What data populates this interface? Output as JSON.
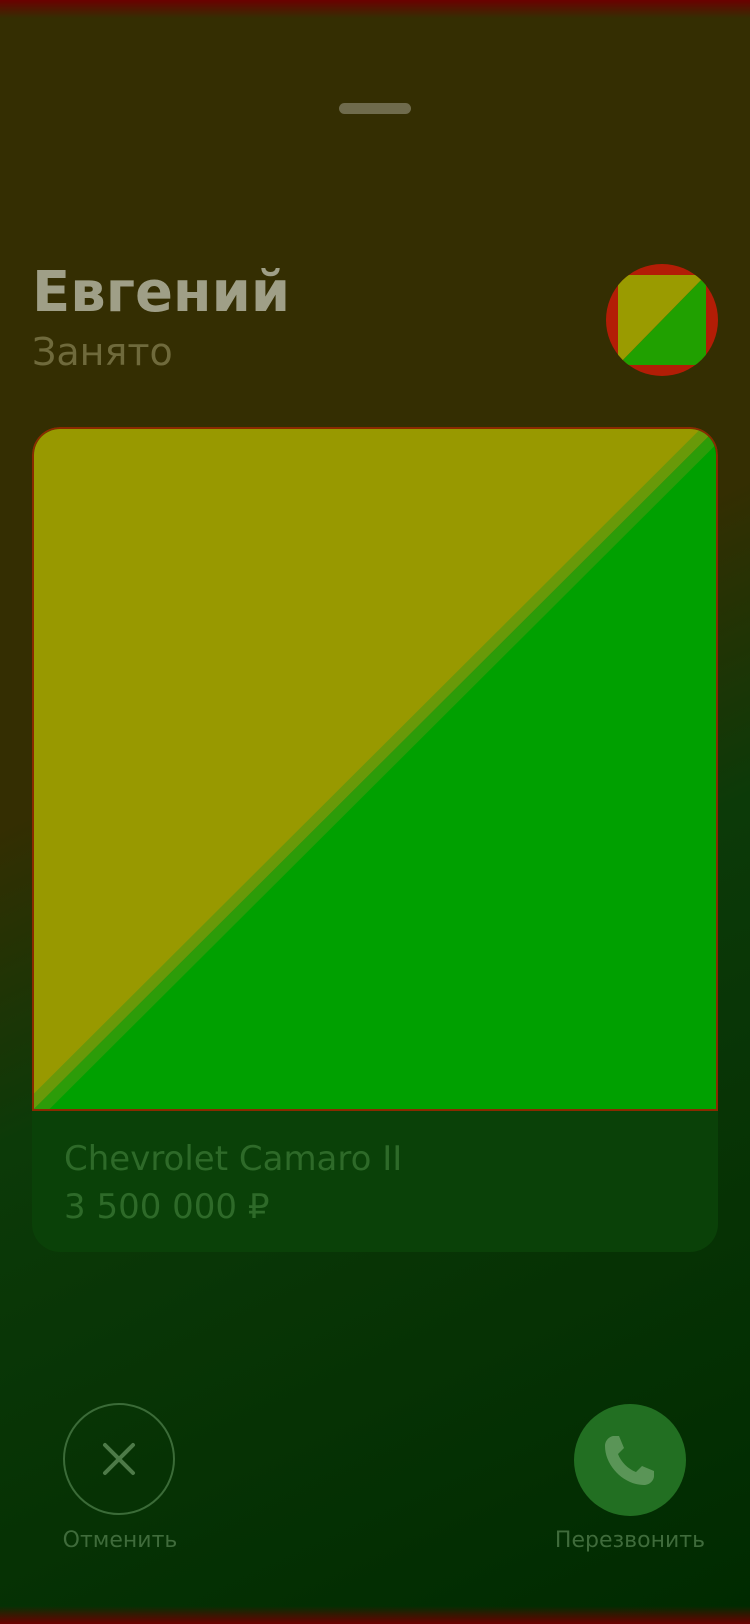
{
  "contact": {
    "name": "Евгений",
    "status": "Занято"
  },
  "listing": {
    "title": "Chevrolet Camaro II",
    "price": "3 500 000 ₽"
  },
  "actions": {
    "cancel_label": "Отменить",
    "callback_label": "Перезвонить"
  },
  "colors": {
    "placeholder_yellow": "#989900",
    "placeholder_green": "#00a000",
    "accent_red": "#b31d06",
    "call_button": "#226f22"
  },
  "icons": {
    "cancel": "close-icon",
    "callback": "phone-icon"
  }
}
